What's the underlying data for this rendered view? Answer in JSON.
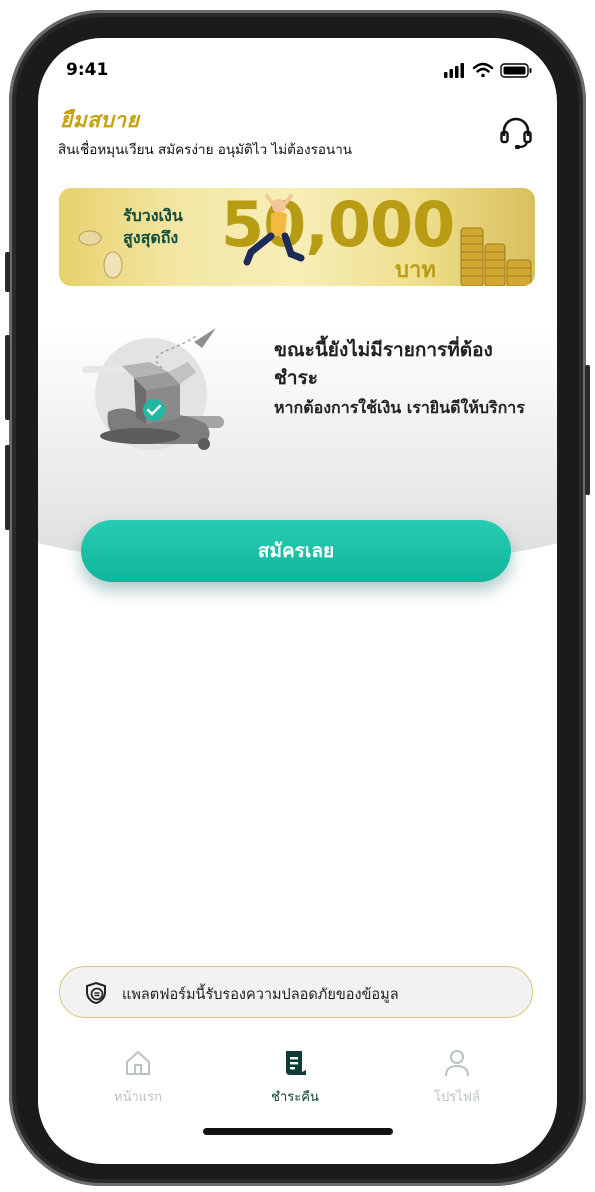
{
  "status_bar": {
    "time": "9:41"
  },
  "header": {
    "brand": "ยืมสบาย",
    "tagline": "สินเชื่อหมุนเวียน สมัครง่าย อนุมัติไว ไม่ต้องรอนาน",
    "support_icon": "headset-icon"
  },
  "banner": {
    "line1": "รับวงเงิน",
    "line2": "สูงสุดถึง",
    "amount": "50,000",
    "unit": "บาท"
  },
  "empty_state": {
    "title": "ขณะนี้ยังไม่มีรายการที่ต้องชำระ",
    "subtitle": "หากต้องการใช้เงิน เรายินดีให้บริการ",
    "icon": "empty-box-icon"
  },
  "apply_button": {
    "label": "สมัครเลย"
  },
  "security_note": {
    "text": "แพลตฟอร์มนี้รับรองความปลอดภัยของข้อมูล",
    "icon": "shield-icon"
  },
  "tabs": [
    {
      "label": "หน้าแรก",
      "icon": "home-icon",
      "active": false
    },
    {
      "label": "ชำระคืน",
      "icon": "bill-icon",
      "active": true
    },
    {
      "label": "โปรไฟล์",
      "icon": "user-icon",
      "active": false
    }
  ],
  "colors": {
    "brand_gold": "#c4a10d",
    "primary_teal": "#16bca3",
    "active_tab": "#0f3d36",
    "inactive_tab": "#b9c4c2"
  }
}
